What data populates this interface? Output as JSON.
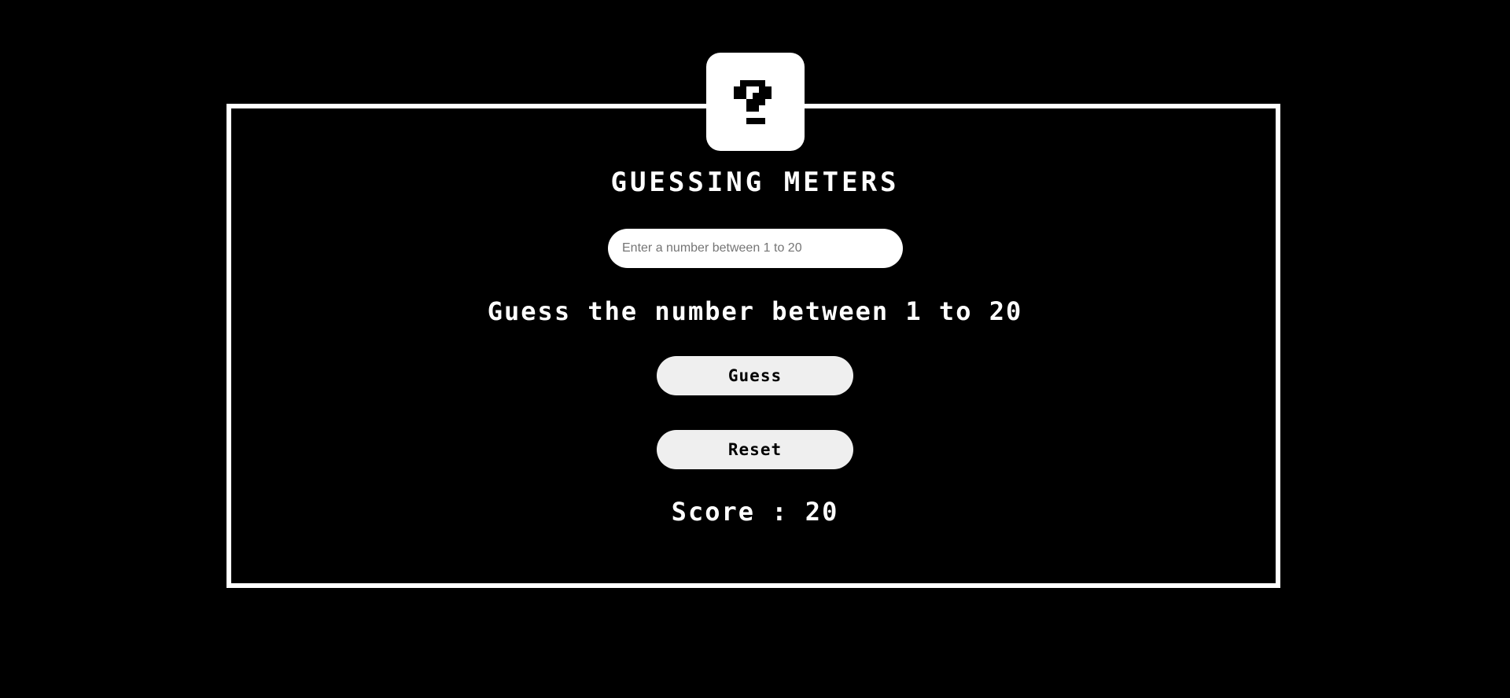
{
  "game": {
    "title": "GUESSING METERS",
    "mystery_icon": "question-mark-icon",
    "input_value": "",
    "input_placeholder": "Enter a number between 1 to 20",
    "hint": "Guess the number between 1 to 20",
    "guess_label": "Guess",
    "reset_label": "Reset",
    "score_text": "Score : 20"
  },
  "colors": {
    "background": "#000000",
    "foreground": "#ffffff",
    "button_bg": "#efefef"
  }
}
